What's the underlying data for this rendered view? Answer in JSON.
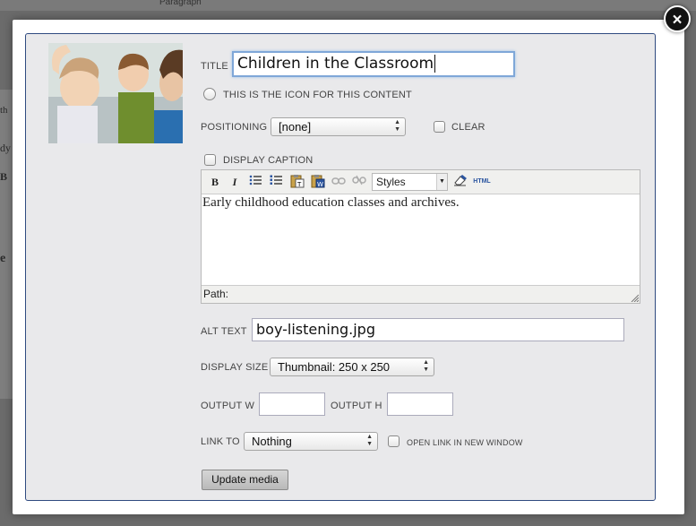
{
  "backdrop": {
    "toolbar_format": "Paragraph",
    "fragments": [
      "th",
      "dy",
      "B",
      "e"
    ]
  },
  "modal": {
    "close_glyph": "×",
    "title_label": "TITLE",
    "title_value": "Children in the Classroom",
    "icon_label": "THIS IS THE ICON FOR THIS CONTENT",
    "positioning_label": "POSITIONING",
    "positioning_value": "[none]",
    "clear_label": "CLEAR",
    "caption_label": "DISPLAY CAPTION",
    "editor": {
      "styles_value": "Styles",
      "html_label": "HTML",
      "content": "Early childhood education classes and archives.",
      "path_label": "Path:"
    },
    "alt_label": "ALT TEXT",
    "alt_value": "boy-listening.jpg",
    "display_size_label": "DISPLAY SIZE",
    "display_size_value": "Thumbnail: 250 x 250",
    "output_w_label": "OUTPUT W",
    "output_w_value": "",
    "output_h_label": "OUTPUT H",
    "output_h_value": "",
    "link_to_label": "LINK TO",
    "link_to_value": "Nothing",
    "open_new_window_label": "OPEN LINK IN NEW WINDOW",
    "update_button": "Update media"
  },
  "colors": {
    "panel_bg": "#e9e9eb",
    "panel_border": "#2f4a80",
    "focus_ring": "#7fa7d8"
  }
}
